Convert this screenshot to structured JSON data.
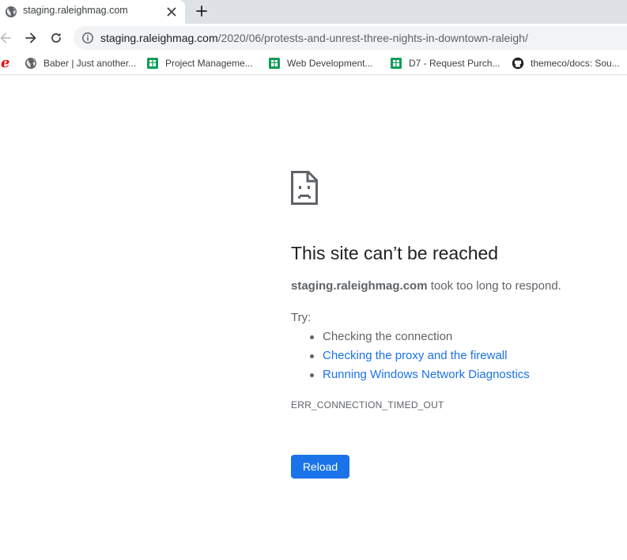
{
  "tab": {
    "title": "staging.raleighmag.com",
    "favicon_icon": "globe-icon",
    "close_icon": "close-icon",
    "new_tab_icon": "plus-icon"
  },
  "toolbar": {
    "back_icon": "arrow-left-icon",
    "forward_icon": "arrow-right-icon",
    "reload_icon": "reload-icon",
    "site_info_icon": "info-icon"
  },
  "address_bar": {
    "host": "staging.raleighmag.com",
    "path": "/2020/06/protests-and-unrest-three-nights-in-downtown-raleigh/"
  },
  "bookmarks": [
    {
      "label": "",
      "icon": "ie-icon"
    },
    {
      "label": "Baber | Just another...",
      "icon": "globe-icon"
    },
    {
      "label": "Project Manageme...",
      "icon": "sheets-icon"
    },
    {
      "label": "Web Development...",
      "icon": "sheets-icon"
    },
    {
      "label": "D7 - Request Purch...",
      "icon": "sheets-icon"
    },
    {
      "label": "themeco/docs: Sou...",
      "icon": "github-icon"
    }
  ],
  "error": {
    "icon": "sad-page-icon",
    "title": "This site can’t be reached",
    "host": "staging.raleighmag.com",
    "message": " took too long to respond.",
    "try_label": "Try:",
    "suggestions": [
      {
        "text": "Checking the connection",
        "is_link": false
      },
      {
        "text": "Checking the proxy and the firewall",
        "is_link": true
      },
      {
        "text": "Running Windows Network Diagnostics",
        "is_link": true
      }
    ],
    "code": "ERR_CONNECTION_TIMED_OUT",
    "reload_label": "Reload"
  },
  "colors": {
    "link": "#1a73e8",
    "button": "#1a73e8",
    "tabstrip": "#dee1e6",
    "omnibox": "#f1f3f4",
    "sheets_green": "#0f9d58",
    "ie_red": "#e8110f"
  }
}
